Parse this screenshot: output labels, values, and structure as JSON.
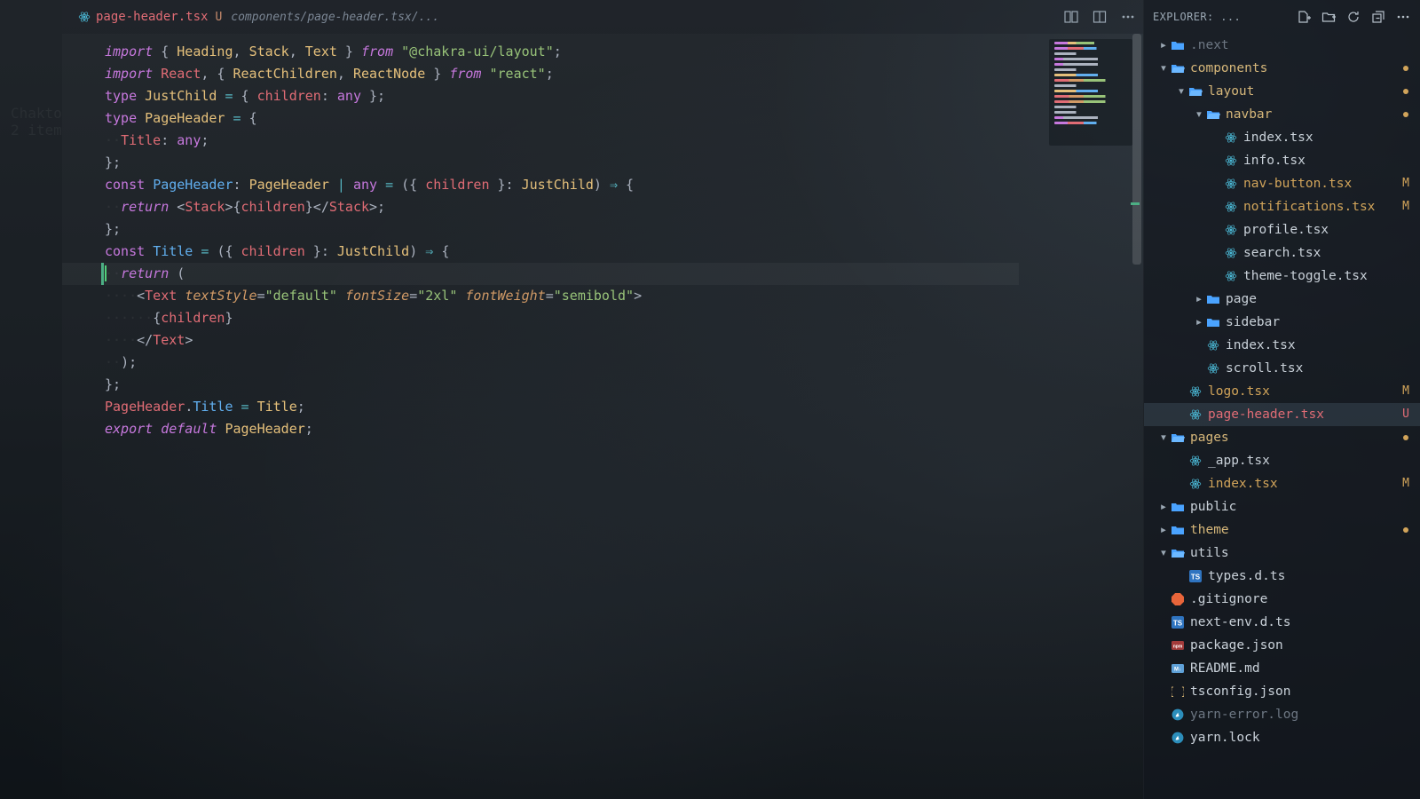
{
  "tab": {
    "filename": "page-header.tsx",
    "badge": "U",
    "subpath": "components/page-header.tsx/..."
  },
  "watermark": {
    "l1": "Chakto",
    "l2": "2 item"
  },
  "code": [
    [
      [
        "kw-imp",
        "import"
      ],
      [
        "white",
        " "
      ],
      [
        "punct",
        "{ "
      ],
      [
        "ident",
        "Heading"
      ],
      [
        "punct",
        ", "
      ],
      [
        "ident",
        "Stack"
      ],
      [
        "punct",
        ", "
      ],
      [
        "ident",
        "Text"
      ],
      [
        "punct",
        " } "
      ],
      [
        "kw-imp",
        "from"
      ],
      [
        "white",
        " "
      ],
      [
        "str",
        "\"@chakra-ui/layout\""
      ],
      [
        "punct",
        ";"
      ]
    ],
    [
      [
        "kw-imp",
        "import"
      ],
      [
        "white",
        " "
      ],
      [
        "ident2",
        "React"
      ],
      [
        "punct",
        ", { "
      ],
      [
        "ident",
        "ReactChildren"
      ],
      [
        "punct",
        ", "
      ],
      [
        "ident",
        "ReactNode"
      ],
      [
        "punct",
        " } "
      ],
      [
        "kw-imp",
        "from"
      ],
      [
        "white",
        " "
      ],
      [
        "str",
        "\"react\""
      ],
      [
        "punct",
        ";"
      ]
    ],
    [],
    [
      [
        "kw",
        "type"
      ],
      [
        "white",
        " "
      ],
      [
        "ty",
        "JustChild"
      ],
      [
        "white",
        " "
      ],
      [
        "op",
        "="
      ],
      [
        "white",
        " "
      ],
      [
        "punct",
        "{ "
      ],
      [
        "ident2",
        "children"
      ],
      [
        "punct",
        ": "
      ],
      [
        "kw",
        "any"
      ],
      [
        "punct",
        " };"
      ]
    ],
    [
      [
        "kw",
        "type"
      ],
      [
        "white",
        " "
      ],
      [
        "ty",
        "PageHeader"
      ],
      [
        "white",
        " "
      ],
      [
        "op",
        "="
      ],
      [
        "white",
        " "
      ],
      [
        "punct",
        "{"
      ]
    ],
    [
      [
        "ws",
        "··"
      ],
      [
        "ident2",
        "Title"
      ],
      [
        "punct",
        ": "
      ],
      [
        "kw",
        "any"
      ],
      [
        "punct",
        ";"
      ]
    ],
    [
      [
        "punct",
        "};"
      ]
    ],
    [
      [
        "kw",
        "const"
      ],
      [
        "white",
        " "
      ],
      [
        "var",
        "PageHeader"
      ],
      [
        "punct",
        ": "
      ],
      [
        "ty",
        "PageHeader"
      ],
      [
        "white",
        " "
      ],
      [
        "op",
        "|"
      ],
      [
        "white",
        " "
      ],
      [
        "kw",
        "any"
      ],
      [
        "white",
        " "
      ],
      [
        "op",
        "="
      ],
      [
        "white",
        " "
      ],
      [
        "punct",
        "({ "
      ],
      [
        "ident2",
        "children"
      ],
      [
        "punct",
        " }: "
      ],
      [
        "ty",
        "JustChild"
      ],
      [
        "punct",
        ") "
      ],
      [
        "op",
        "⇒"
      ],
      [
        "white",
        " "
      ],
      [
        "punct",
        "{"
      ]
    ],
    [
      [
        "ws",
        "··"
      ],
      [
        "kw-imp",
        "return"
      ],
      [
        "white",
        " "
      ],
      [
        "punct",
        "<"
      ],
      [
        "tag",
        "Stack"
      ],
      [
        "punct",
        ">{"
      ],
      [
        "ident2",
        "children"
      ],
      [
        "punct",
        "}</"
      ],
      [
        "tag",
        "Stack"
      ],
      [
        "punct",
        ">;"
      ]
    ],
    [
      [
        "punct",
        "};"
      ]
    ],
    [],
    [
      [
        "kw",
        "const"
      ],
      [
        "white",
        " "
      ],
      [
        "var",
        "Title"
      ],
      [
        "white",
        " "
      ],
      [
        "op",
        "="
      ],
      [
        "white",
        " "
      ],
      [
        "punct",
        "({ "
      ],
      [
        "ident2",
        "children"
      ],
      [
        "punct",
        " }: "
      ],
      [
        "ty",
        "JustChild"
      ],
      [
        "punct",
        ") "
      ],
      [
        "op",
        "⇒"
      ],
      [
        "white",
        " "
      ],
      [
        "punct",
        "{"
      ]
    ],
    [
      [
        "ws",
        "··"
      ],
      [
        "kw-imp",
        "return"
      ],
      [
        "white",
        " "
      ],
      [
        "punct",
        "("
      ]
    ],
    [
      [
        "ws",
        "····"
      ],
      [
        "punct",
        "<"
      ],
      [
        "tag",
        "Text"
      ],
      [
        "white",
        " "
      ],
      [
        "attr",
        "textStyle"
      ],
      [
        "punct",
        "="
      ],
      [
        "attrval",
        "\"default\""
      ],
      [
        "white",
        " "
      ],
      [
        "attr",
        "fontSize"
      ],
      [
        "punct",
        "="
      ],
      [
        "attrval",
        "\"2xl\""
      ],
      [
        "white",
        " "
      ],
      [
        "attr",
        "fontWeight"
      ],
      [
        "punct",
        "="
      ],
      [
        "attrval",
        "\"semibold\""
      ],
      [
        "punct",
        ">"
      ]
    ],
    [
      [
        "ws",
        "······"
      ],
      [
        "punct",
        "{"
      ],
      [
        "ident2",
        "children"
      ],
      [
        "punct",
        "}"
      ]
    ],
    [
      [
        "ws",
        "····"
      ],
      [
        "punct",
        "</"
      ],
      [
        "tag",
        "Text"
      ],
      [
        "punct",
        ">"
      ]
    ],
    [
      [
        "ws",
        "··"
      ],
      [
        "punct",
        ");"
      ]
    ],
    [
      [
        "punct",
        "};"
      ]
    ],
    [],
    [
      [
        "ident2",
        "PageHeader"
      ],
      [
        "punct",
        "."
      ],
      [
        "fn",
        "Title"
      ],
      [
        "white",
        " "
      ],
      [
        "op",
        "="
      ],
      [
        "white",
        " "
      ],
      [
        "ident",
        "Title"
      ],
      [
        "punct",
        ";"
      ]
    ],
    [
      [
        "kw-imp",
        "export"
      ],
      [
        "white",
        " "
      ],
      [
        "kw-imp",
        "default"
      ],
      [
        "white",
        " "
      ],
      [
        "ident",
        "PageHeader"
      ],
      [
        "punct",
        ";"
      ]
    ]
  ],
  "explorer": {
    "title": "EXPLORER: ...",
    "rows": [
      {
        "depth": 0,
        "kind": "folder",
        "open": false,
        "name": ".next",
        "mod": "",
        "color": "muted"
      },
      {
        "depth": 0,
        "kind": "folder",
        "open": true,
        "name": "components",
        "mod": "dot",
        "color": "folder-mod"
      },
      {
        "depth": 1,
        "kind": "folder",
        "open": true,
        "name": "layout",
        "mod": "dot",
        "color": "folder-mod"
      },
      {
        "depth": 2,
        "kind": "folder",
        "open": true,
        "name": "navbar",
        "mod": "dot",
        "color": "folder-mod"
      },
      {
        "depth": 3,
        "kind": "react",
        "name": "index.tsx",
        "mod": ""
      },
      {
        "depth": 3,
        "kind": "react",
        "name": "info.tsx",
        "mod": ""
      },
      {
        "depth": 3,
        "kind": "react",
        "name": "nav-button.tsx",
        "mod": "M"
      },
      {
        "depth": 3,
        "kind": "react",
        "name": "notifications.tsx",
        "mod": "M"
      },
      {
        "depth": 3,
        "kind": "react",
        "name": "profile.tsx",
        "mod": ""
      },
      {
        "depth": 3,
        "kind": "react",
        "name": "search.tsx",
        "mod": ""
      },
      {
        "depth": 3,
        "kind": "react",
        "name": "theme-toggle.tsx",
        "mod": ""
      },
      {
        "depth": 2,
        "kind": "folder",
        "open": false,
        "name": "page",
        "mod": "",
        "color": "folder"
      },
      {
        "depth": 2,
        "kind": "folder",
        "open": false,
        "name": "sidebar",
        "mod": "",
        "color": "folder"
      },
      {
        "depth": 2,
        "kind": "react",
        "name": "index.tsx",
        "mod": ""
      },
      {
        "depth": 2,
        "kind": "react",
        "name": "scroll.tsx",
        "mod": ""
      },
      {
        "depth": 1,
        "kind": "react",
        "name": "logo.tsx",
        "mod": "M"
      },
      {
        "depth": 1,
        "kind": "react",
        "name": "page-header.tsx",
        "mod": "U",
        "selected": true
      },
      {
        "depth": 0,
        "kind": "folder",
        "open": true,
        "name": "pages",
        "mod": "dot",
        "color": "folder-mod"
      },
      {
        "depth": 1,
        "kind": "react",
        "name": "_app.tsx",
        "mod": ""
      },
      {
        "depth": 1,
        "kind": "react",
        "name": "index.tsx",
        "mod": "M"
      },
      {
        "depth": 0,
        "kind": "folder",
        "open": false,
        "name": "public",
        "mod": "",
        "color": "folder"
      },
      {
        "depth": 0,
        "kind": "folder",
        "open": false,
        "name": "theme",
        "mod": "dot",
        "color": "folder-mod"
      },
      {
        "depth": 0,
        "kind": "folder",
        "open": true,
        "name": "utils",
        "mod": "",
        "color": "folder"
      },
      {
        "depth": 1,
        "kind": "ts",
        "name": "types.d.ts",
        "mod": ""
      },
      {
        "depth": 0,
        "kind": "git",
        "name": ".gitignore",
        "mod": ""
      },
      {
        "depth": 0,
        "kind": "ts",
        "name": "next-env.d.ts",
        "mod": ""
      },
      {
        "depth": 0,
        "kind": "json",
        "name": "package.json",
        "mod": ""
      },
      {
        "depth": 0,
        "kind": "md",
        "name": "README.md",
        "mod": ""
      },
      {
        "depth": 0,
        "kind": "braces",
        "name": "tsconfig.json",
        "mod": ""
      },
      {
        "depth": 0,
        "kind": "yarn",
        "name": "yarn-error.log",
        "mod": "",
        "color": "muted"
      },
      {
        "depth": 0,
        "kind": "yarn",
        "name": "yarn.lock",
        "mod": ""
      }
    ]
  }
}
